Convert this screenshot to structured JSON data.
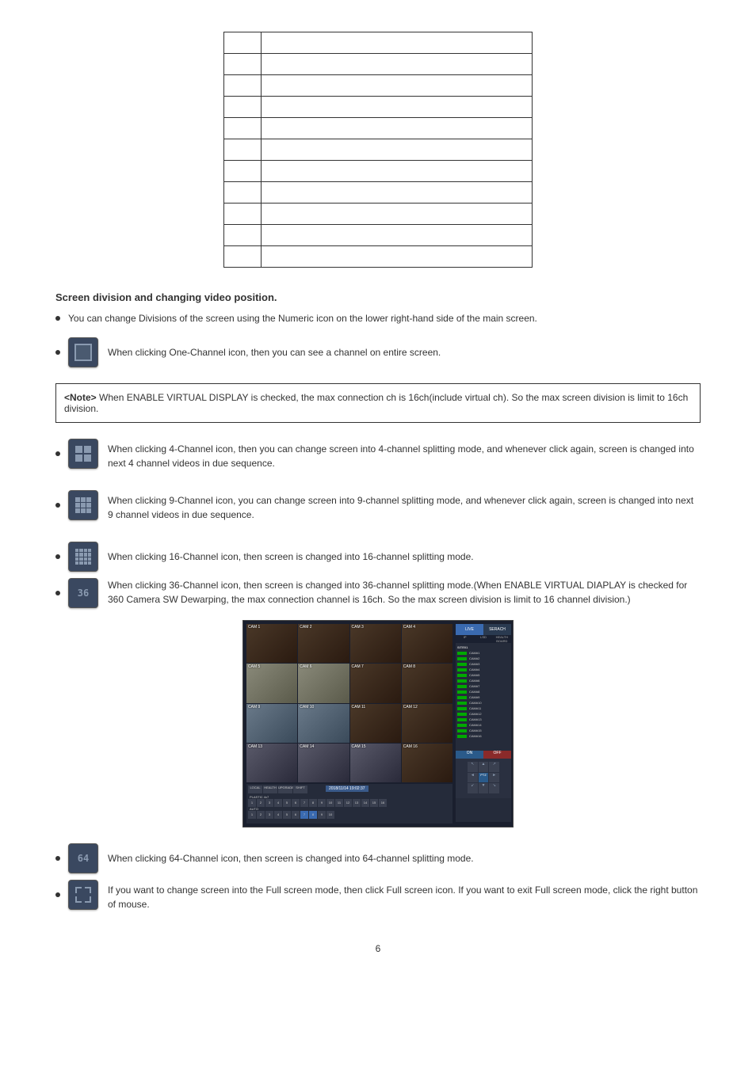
{
  "table": {
    "rows": [
      {
        "no": "",
        "desc": ""
      },
      {
        "no": "",
        "desc": ""
      },
      {
        "no": "",
        "desc": ""
      },
      {
        "no": "",
        "desc": ""
      },
      {
        "no": "",
        "desc": ""
      },
      {
        "no": "",
        "desc": ""
      },
      {
        "no": "",
        "desc": ""
      },
      {
        "no": "",
        "desc": ""
      },
      {
        "no": "",
        "desc": ""
      },
      {
        "no": "",
        "desc": ""
      },
      {
        "no": "",
        "desc": ""
      }
    ]
  },
  "section1": {
    "title": "Screen division and changing video position.",
    "bullet1": "You can change Divisions of the screen using the Numeric icon on the lower right-hand side of the main screen.",
    "bullet2": "When clicking One-Channel icon, then you can see a channel on entire screen."
  },
  "note": {
    "title": "<Note>",
    "text": "When ENABLE VIRTUAL DISPLAY is checked, the max connection ch is 16ch(include virtual ch). So the max screen division is limit to 16ch division."
  },
  "grid_bullets": {
    "four": "When clicking 4-Channel icon, then you can change screen into 4-channel splitting mode, and whenever click again, screen is changed into next 4 channel videos in due sequence.",
    "nine": "When clicking 9-Channel icon, you can change screen into 9-channel splitting mode, and whenever click again, screen is changed into next 9 channel videos in due sequence.",
    "sixteen": "When clicking 16-Channel icon, then screen is changed into 16-channel splitting mode.",
    "thirtysix": "When clicking 36-Channel icon, then screen is changed into 36-channel splitting mode.(When ENABLE VIRTUAL DIAPLAY is checked for 360 Camera SW Dewarping, the max connection channel is 16ch. So the max screen division is limit to 16 channel division.)"
  },
  "screenshot": {
    "cameras": [
      "CAM 1",
      "CAM 2",
      "CAM 3",
      "CAM 4",
      "CAM 5",
      "CAM 6",
      "CAM 7",
      "CAM 8",
      "CAM 9",
      "CAM 10",
      "CAM 11",
      "CAM 12",
      "CAM 13",
      "CAM 14",
      "CAM 15",
      "CAM 16"
    ],
    "tabs": {
      "live": "LIVE",
      "search": "SERACH"
    },
    "subtabs": [
      "IP",
      "LSD",
      "HEALTH BOARD"
    ],
    "site_label": "SITE01",
    "camlist": [
      "CAM#1",
      "CAM#2",
      "CAM#3",
      "CAM#4",
      "CAM#5",
      "CAM#6",
      "CAM#7",
      "CAM#8",
      "CAM#9",
      "CAM#10",
      "CAM#11",
      "CAM#12",
      "CAM#13",
      "CAM#14",
      "CAM#15",
      "CAM#16"
    ],
    "onoff": {
      "on": "ON",
      "off": "OFF"
    },
    "ptz_label": "PTZ",
    "ptz_arrows": [
      "↖",
      "▲",
      "↗",
      "◄",
      "",
      "►",
      "↙",
      "▼",
      "↘"
    ],
    "bottom_btns": [
      "LOCAL",
      "HEALTH",
      "UPGRADE",
      "SHIFT"
    ],
    "timestamp": "2018/11/14 19:02:37",
    "plastics": "PLASTIC 4x7",
    "auto_label": "AUTO",
    "nums": [
      "1",
      "2",
      "3",
      "4",
      "5",
      "6",
      "7",
      "8",
      "9",
      "10",
      "11",
      "12",
      "13",
      "14",
      "15",
      "16"
    ],
    "active_nums": [
      6,
      7
    ]
  },
  "bottom_bullets": {
    "sixtyfour": "When clicking 64-Channel icon, then screen is changed into 64-channel splitting mode.",
    "fullscreen": "If you want to change screen into the Full screen mode, then click Full screen icon. If you want to exit Full screen mode, click the right button of mouse."
  },
  "page_number": "6"
}
